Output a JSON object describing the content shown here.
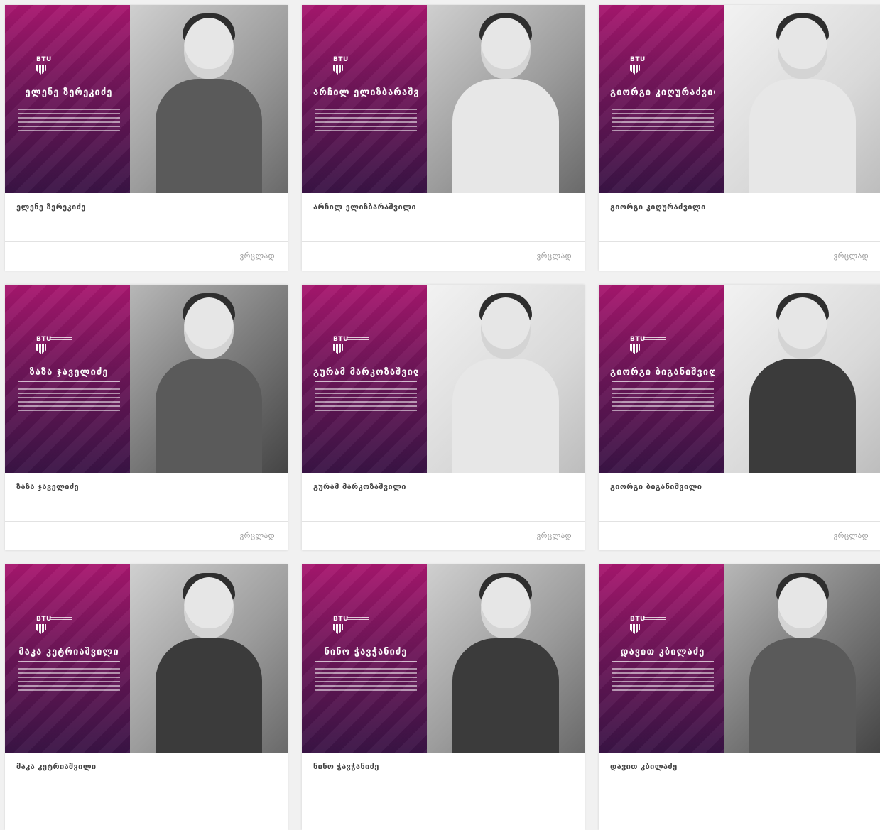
{
  "profiles": [
    {
      "name": "ელენე ზერეკიძე",
      "banner_name": "ელენე ზერეკიძე",
      "more_label": "ვრცლად",
      "photo_tone": "default",
      "attire": "jacket"
    },
    {
      "name": "არჩილ ელიზბარაშვილი",
      "banner_name": "არჩილ ელიზბარაშვილი",
      "more_label": "ვრცლად",
      "photo_tone": "default",
      "attire": "lightc"
    },
    {
      "name": "გიორგი კიღურაძვილი",
      "banner_name": "გიორგი კიღურაძვილი",
      "more_label": "ვრცლად",
      "photo_tone": "light",
      "attire": "lightc"
    },
    {
      "name": "ზაზა ჯაველიძე",
      "banner_name": "ზაზა ჯაველიძე",
      "more_label": "ვრცლად",
      "photo_tone": "dark",
      "attire": "jacket"
    },
    {
      "name": "გურამ მარკოზაშვილი",
      "banner_name": "გურამ მარკოზაშვილი",
      "more_label": "ვრცლად",
      "photo_tone": "light",
      "attire": "lightc"
    },
    {
      "name": "გიორგი ბიგანიშვილი",
      "banner_name": "გიორგი ბიგანიშვილი",
      "more_label": "ვრცლად",
      "photo_tone": "light",
      "attire": "dark"
    },
    {
      "name": "მაკა კეტრიაშვილი",
      "banner_name": "მაკა კეტრიაშვილი",
      "more_label": "",
      "photo_tone": "default",
      "attire": "dark"
    },
    {
      "name": "ნინო ჭავჭანიძე",
      "banner_name": "ნინო ჭავჭანიძე",
      "more_label": "",
      "photo_tone": "default",
      "attire": "dark"
    },
    {
      "name": "დავით კბილაძე",
      "banner_name": "დავით კბილაძე",
      "more_label": "",
      "photo_tone": "dark",
      "attire": "jacket"
    }
  ],
  "brand": {
    "logo_text": "BTU",
    "accent": "#a8176f",
    "accent_dark": "#3a1446"
  }
}
